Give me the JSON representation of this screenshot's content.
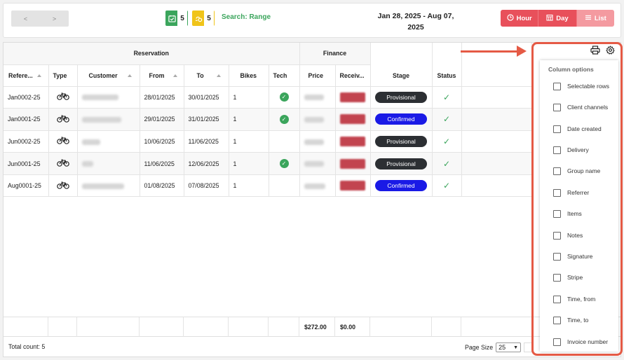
{
  "toolbar": {
    "prev_label": "<",
    "next_label": ">",
    "badge_green_count": "5",
    "badge_yellow_count": "5",
    "search_label": "Search: Range",
    "date_range_line1": "Jan 28, 2025 - Aug 07,",
    "date_range_line2": "2025",
    "views": [
      {
        "label": "Hour",
        "icon": "clock-icon"
      },
      {
        "label": "Day",
        "icon": "calendar-grid-icon"
      },
      {
        "label": "List",
        "icon": "list-icon"
      }
    ]
  },
  "grid": {
    "groups": {
      "reservation": "Reservation",
      "finance": "Finance"
    },
    "headers": {
      "reference": "Refere...",
      "type": "Type",
      "customer": "Customer",
      "from": "From",
      "to": "To",
      "bikes": "Bikes",
      "tech": "Tech",
      "price": "Price",
      "received": "Receiv...",
      "stage": "Stage",
      "status": "Status"
    },
    "rows": [
      {
        "ref": "Jan0002-25",
        "from": "28/01/2025",
        "to": "30/01/2025",
        "bikes": "1",
        "tech": true,
        "stage": "Provisional",
        "stage_type": "prov"
      },
      {
        "ref": "Jan0001-25",
        "from": "29/01/2025",
        "to": "31/01/2025",
        "bikes": "1",
        "tech": true,
        "stage": "Confirmed",
        "stage_type": "conf"
      },
      {
        "ref": "Jun0002-25",
        "from": "10/06/2025",
        "to": "11/06/2025",
        "bikes": "1",
        "tech": false,
        "stage": "Provisional",
        "stage_type": "prov"
      },
      {
        "ref": "Jun0001-25",
        "from": "11/06/2025",
        "to": "12/06/2025",
        "bikes": "1",
        "tech": true,
        "stage": "Provisional",
        "stage_type": "prov"
      },
      {
        "ref": "Aug0001-25",
        "from": "01/08/2025",
        "to": "07/08/2025",
        "bikes": "1",
        "tech": false,
        "stage": "Confirmed",
        "stage_type": "conf"
      }
    ],
    "totals": {
      "price": "$272.00",
      "received": "$0.00"
    },
    "total_count": "Total count: 5",
    "page_size_label": "Page Size",
    "page_size_value": "25"
  },
  "column_options": {
    "title": "Column options",
    "items": [
      "Selectable rows",
      "Client channels",
      "Date created",
      "Delivery",
      "Group name",
      "Referrer",
      "Items",
      "Notes",
      "Signature",
      "Stripe",
      "Time, from",
      "Time, to",
      "Invoice number"
    ]
  },
  "colors": {
    "accent_red": "#e8505b",
    "annotation": "#e55a45",
    "green": "#3ba55c",
    "yellow": "#f0c419",
    "stage_provisional": "#2c2f33",
    "stage_confirmed": "#1a1ae6"
  }
}
